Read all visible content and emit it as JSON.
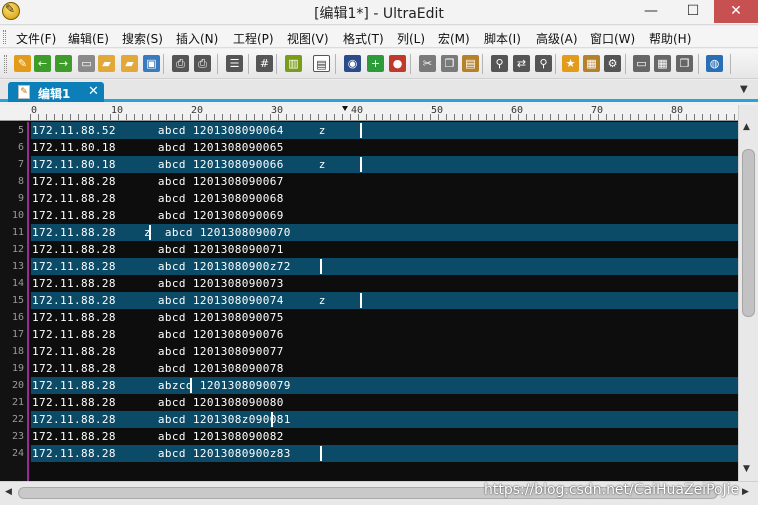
{
  "window": {
    "title": "[编辑1*] - UltraEdit",
    "minimize_glyph": "—",
    "maximize_glyph": "☐",
    "close_glyph": "✕"
  },
  "menu": {
    "items": [
      "文件(F)",
      "编辑(E)",
      "搜索(S)",
      "插入(N)",
      "工程(P)",
      "视图(V)",
      "格式(T)",
      "列(L)",
      "宏(M)",
      "脚本(I)",
      "高级(A)",
      "窗口(W)",
      "帮助(H)"
    ]
  },
  "toolbar": {
    "buttons": [
      {
        "icon": "open-folder-icon",
        "color": "#e39b1b"
      },
      {
        "icon": "back-arrow-icon",
        "color": "#3e9c2b"
      },
      {
        "icon": "forward-arrow-icon",
        "color": "#3e9c2b"
      },
      {
        "icon": "new-file-icon",
        "color": "#8a8a8a"
      },
      {
        "icon": "open-file-icon",
        "color": "#e2a83a"
      },
      {
        "icon": "open-project-icon",
        "color": "#e2a83a"
      },
      {
        "icon": "save-icon",
        "color": "#3a7bbf"
      },
      {
        "icon": "print-icon",
        "color": "#555555"
      },
      {
        "icon": "print-preview-icon",
        "color": "#555555"
      },
      {
        "icon": "list-icon",
        "color": "#555555"
      },
      {
        "icon": "hex-icon",
        "color": "#555555"
      },
      {
        "icon": "column-icon",
        "color": "#7a9c1b"
      },
      {
        "icon": "column-mode-icon",
        "color": "#333333",
        "selected": true
      },
      {
        "icon": "tool-icon",
        "color": "#2c4b8a"
      },
      {
        "icon": "add-icon",
        "color": "#2e9b3a"
      },
      {
        "icon": "remove-icon",
        "color": "#c0392b"
      },
      {
        "icon": "cut-icon",
        "color": "#7a7a7a"
      },
      {
        "icon": "copy-icon",
        "color": "#7a7a7a"
      },
      {
        "icon": "paste-icon",
        "color": "#b5812b"
      },
      {
        "icon": "find-icon",
        "color": "#555555"
      },
      {
        "icon": "replace-icon",
        "color": "#555555"
      },
      {
        "icon": "find-in-files-icon",
        "color": "#555555"
      },
      {
        "icon": "bookmark-icon",
        "color": "#e39b1b"
      },
      {
        "icon": "macro-icon",
        "color": "#b5812b"
      },
      {
        "icon": "settings-icon",
        "color": "#555555"
      },
      {
        "icon": "window-icon",
        "color": "#666666"
      },
      {
        "icon": "tile-icon",
        "color": "#666666"
      },
      {
        "icon": "cascade-icon",
        "color": "#666666"
      },
      {
        "icon": "web-icon",
        "color": "#2a6fb3"
      }
    ]
  },
  "tab": {
    "label": "编辑1",
    "close_glyph": "✕",
    "dropdown_glyph": "▼"
  },
  "ruler": {
    "labels": [
      "0",
      "10",
      "20",
      "30",
      "40",
      "50",
      "60",
      "70",
      "80"
    ]
  },
  "editor": {
    "lines": [
      {
        "num": "5",
        "text": "172.11.88.52      abcd 1201308090064     z",
        "selected": true
      },
      {
        "num": "6",
        "text": "172.11.80.18      abcd 1201308090065",
        "selected": false
      },
      {
        "num": "7",
        "text": "172.11.80.18      abcd 1201308090066     z",
        "selected": true
      },
      {
        "num": "8",
        "text": "172.11.88.28      abcd 1201308090067",
        "selected": false
      },
      {
        "num": "9",
        "text": "172.11.88.28      abcd 1201308090068",
        "selected": false
      },
      {
        "num": "10",
        "text": "172.11.88.28      abcd 1201308090069",
        "selected": false
      },
      {
        "num": "11",
        "text": "172.11.88.28    z  abcd 1201308090070",
        "selected": true
      },
      {
        "num": "12",
        "text": "172.11.88.28      abcd 1201308090071",
        "selected": false
      },
      {
        "num": "13",
        "text": "172.11.88.28      abcd 12013080900z72",
        "selected": true
      },
      {
        "num": "14",
        "text": "172.11.88.28      abcd 1201308090073",
        "selected": false
      },
      {
        "num": "15",
        "text": "172.11.88.28      abcd 1201308090074     z",
        "selected": true
      },
      {
        "num": "16",
        "text": "172.11.88.28      abcd 1201308090075",
        "selected": false
      },
      {
        "num": "17",
        "text": "172.11.88.28      abcd 1201308090076",
        "selected": false
      },
      {
        "num": "18",
        "text": "172.11.88.28      abcd 1201308090077",
        "selected": false
      },
      {
        "num": "19",
        "text": "172.11.88.28      abcd 1201308090078",
        "selected": false
      },
      {
        "num": "20",
        "text": "172.11.88.28      abzcd 1201308090079",
        "selected": true
      },
      {
        "num": "21",
        "text": "172.11.88.28      abcd 1201308090080",
        "selected": false
      },
      {
        "num": "22",
        "text": "172.11.88.28      abcd 1201308z090081",
        "selected": true
      },
      {
        "num": "23",
        "text": "172.11.88.28      abcd 1201308090082",
        "selected": false
      },
      {
        "num": "24",
        "text": "172.11.88.28      abcd 12013080900z83",
        "selected": true
      }
    ]
  },
  "scrollbar": {
    "up_glyph": "▲",
    "down_glyph": "▼",
    "left_glyph": "◀",
    "right_glyph": "▶"
  },
  "watermark": "https://blog.csdn.net/CaiHuaZeiPoJie"
}
